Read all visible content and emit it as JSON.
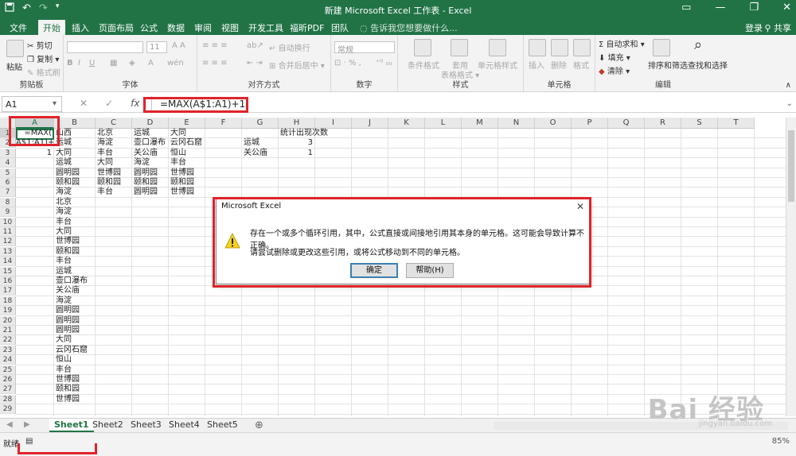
{
  "titlebar": {
    "title": "新建 Microsoft Excel 工作表 - Excel",
    "save_icon": "save-icon",
    "undo_icon": "undo-icon",
    "redo_icon": "redo-icon",
    "brand_color": "#217346"
  },
  "tabs": [
    "文件",
    "开始",
    "插入",
    "页面布局",
    "公式",
    "数据",
    "审阅",
    "视图",
    "开发工具",
    "福昕PDF",
    "团队"
  ],
  "active_tab": "开始",
  "tellme": "告诉我您想要做什么...",
  "account": {
    "login": "登录",
    "share": "共享"
  },
  "ribbon": {
    "clipboard": {
      "paste": "粘贴",
      "cut": "剪切",
      "copy": "复制 ▾",
      "format_painter": "格式刷",
      "label": "剪贴板"
    },
    "font": {
      "size": "11",
      "label": "字体"
    },
    "alignment": {
      "wrap": "自动换行",
      "merge": "合并后居中 ▾",
      "label": "对齐方式"
    },
    "number": {
      "format": "常规",
      "label": "数字"
    },
    "styles": {
      "conditional": "条件格式",
      "table": "套用",
      "table2": "表格格式 ▾",
      "cell_styles": "单元格样式",
      "label": "样式"
    },
    "cells": {
      "insert": "插入",
      "delete": "删除",
      "format": "格式",
      "label": "单元格"
    },
    "editing": {
      "autosum": "自动求和 ▾",
      "fill": "填充 ▾",
      "clear": "清除 ▾",
      "sort": "排序和筛选",
      "find": "查找和选择",
      "label": "编辑"
    }
  },
  "formula_bar": {
    "name_box": "A1",
    "formula": "=MAX(A$1:A1)+1"
  },
  "columns": [
    "A",
    "B",
    "C",
    "D",
    "E",
    "F",
    "G",
    "H",
    "I",
    "J",
    "K",
    "L",
    "M",
    "N",
    "O",
    "P",
    "Q",
    "R",
    "S",
    "T"
  ],
  "rows": [
    "1",
    "2",
    "3",
    "4",
    "5",
    "6",
    "7",
    "8",
    "9",
    "10",
    "11",
    "12",
    "13",
    "14",
    "15",
    "16",
    "17",
    "18",
    "19",
    "20",
    "21",
    "22",
    "23",
    "24",
    "25",
    "26",
    "27",
    "28",
    "29"
  ],
  "cells": {
    "a1": "=MAX(",
    "a2": "A$1:A1)+",
    "a3": "1",
    "b_col": [
      "山西",
      "运城",
      "大同",
      "运城",
      "圆明园",
      "颐和园",
      "海淀",
      "北京",
      "海淀",
      "丰台",
      "大同",
      "世博园",
      "颐和园",
      "丰台",
      "运城",
      "壶口瀑布",
      "关公庙",
      "海淀",
      "圆明园",
      "圆明园",
      "圆明园",
      "大同",
      "云冈石窟",
      "恒山",
      "丰台",
      "世博园",
      "颐和园",
      "世博园"
    ],
    "c_col": [
      "北京",
      "海淀",
      "丰台",
      "大同",
      "世博园",
      "颐和园",
      "丰台"
    ],
    "d_col": [
      "运城",
      "壶口瀑布",
      "关公庙",
      "海淀",
      "圆明园",
      "颐和园",
      "圆明园"
    ],
    "e_col": [
      "大同",
      "云冈石窟",
      "恒山",
      "丰台",
      "世博园",
      "颐和园",
      "世博园"
    ],
    "h1": "统计出现次数",
    "g2": "运城",
    "h2": "3",
    "g3": "关公庙",
    "h3": "1"
  },
  "sheet_tabs": [
    "Sheet1",
    "Sheet2",
    "Sheet3",
    "Sheet4",
    "Sheet5"
  ],
  "active_sheet": "Sheet1",
  "status": {
    "ready": "就绪",
    "zoom": "85%"
  },
  "dialog": {
    "title": "Microsoft Excel",
    "message1": "存在一个或多个循环引用，其中，公式直接或间接地引用其本身的单元格。这可能会导致计算不正确。",
    "message2": "请尝试删除或更改这些引用，或将公式移动到不同的单元格。",
    "ok": "确定",
    "help": "帮助(H)"
  },
  "watermark": {
    "brand": "Bai 经验",
    "url": "jingyan.baidu.com"
  },
  "highlight_color": "#e0232a"
}
